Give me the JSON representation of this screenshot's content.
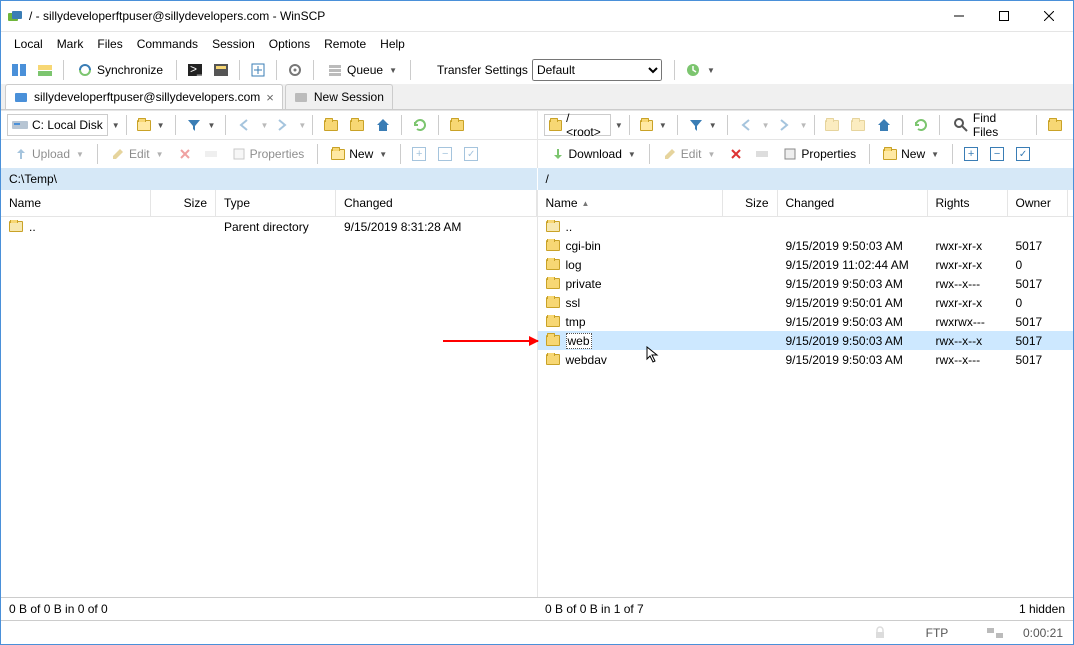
{
  "title": "/ - sillydeveloperftpuser@sillydevelopers.com - WinSCP",
  "menu": [
    "Local",
    "Mark",
    "Files",
    "Commands",
    "Session",
    "Options",
    "Remote",
    "Help"
  ],
  "toolbar1": {
    "synchronize": "Synchronize",
    "queue": "Queue",
    "transfer_label": "Transfer Settings",
    "transfer_value": "Default"
  },
  "tabs": {
    "active": "sillydeveloperftpuser@sillydevelopers.com",
    "new": "New Session"
  },
  "nav": {
    "local_disk": "C: Local Disk",
    "remote_root": "/ <root>",
    "find_files": "Find Files"
  },
  "ops": {
    "upload": "Upload",
    "download": "Download",
    "edit": "Edit",
    "properties": "Properties",
    "new": "New"
  },
  "paths": {
    "local": "C:\\Temp\\",
    "remote": "/"
  },
  "columns": {
    "local": [
      "Name",
      "Size",
      "Type",
      "Changed"
    ],
    "remote": [
      "Name",
      "Size",
      "Changed",
      "Rights",
      "Owner"
    ]
  },
  "local_rows": [
    {
      "name": "..",
      "size": "",
      "type": "Parent directory",
      "changed": "9/15/2019  8:31:28 AM",
      "up": true
    }
  ],
  "remote_rows": [
    {
      "name": "..",
      "up": true
    },
    {
      "name": "cgi-bin",
      "changed": "9/15/2019 9:50:03 AM",
      "rights": "rwxr-xr-x",
      "owner": "5017"
    },
    {
      "name": "log",
      "changed": "9/15/2019 11:02:44 AM",
      "rights": "rwxr-xr-x",
      "owner": "0"
    },
    {
      "name": "private",
      "changed": "9/15/2019 9:50:03 AM",
      "rights": "rwx--x---",
      "owner": "5017"
    },
    {
      "name": "ssl",
      "changed": "9/15/2019 9:50:01 AM",
      "rights": "rwxr-xr-x",
      "owner": "0"
    },
    {
      "name": "tmp",
      "changed": "9/15/2019 9:50:03 AM",
      "rights": "rwxrwx---",
      "owner": "5017"
    },
    {
      "name": "web",
      "changed": "9/15/2019 9:50:03 AM",
      "rights": "rwx--x--x",
      "owner": "5017",
      "selected": true,
      "editing": true
    },
    {
      "name": "webdav",
      "changed": "9/15/2019 9:50:03 AM",
      "rights": "rwx--x---",
      "owner": "5017"
    }
  ],
  "footer": {
    "local": "0 B of 0 B in 0 of 0",
    "remote": "0 B of 0 B in 1 of 7",
    "hidden": "1 hidden"
  },
  "status": {
    "protocol": "FTP",
    "time": "0:00:21"
  }
}
